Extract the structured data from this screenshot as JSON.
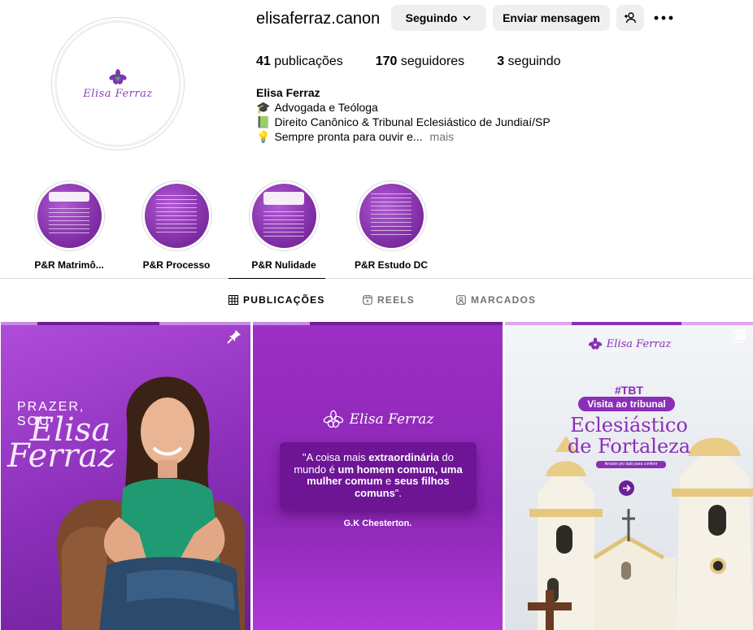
{
  "profile": {
    "username": "elisaferraz.canon",
    "avatar_logo_text": "Elisa Ferraz",
    "buttons": {
      "following": "Seguindo",
      "message": "Enviar mensagem"
    },
    "stats": {
      "posts_count": "41",
      "posts_label": "publicações",
      "followers_count": "170",
      "followers_label": "seguidores",
      "following_count": "3",
      "following_label": "seguindo"
    },
    "bio": {
      "name": "Elisa Ferraz",
      "line1_emoji": "🎓",
      "line1": "Advogada e Teóloga",
      "line2_emoji": "📗",
      "line2": "Direito Canônico & Tribunal Eclesiástico de Jundiaí/SP",
      "line3_emoji": "💡",
      "line3": "Sempre pronta para ouvir e...",
      "more": "mais"
    }
  },
  "highlights": [
    {
      "label": "P&R Matrimô..."
    },
    {
      "label": "P&R Processo"
    },
    {
      "label": "P&R Nulidade"
    },
    {
      "label": "P&R Estudo DC"
    }
  ],
  "tabs": [
    {
      "label": "PUBLICAÇÕES",
      "icon": "grid-icon",
      "active": true
    },
    {
      "label": "REELS",
      "icon": "reels-icon",
      "active": false
    },
    {
      "label": "MARCADOS",
      "icon": "tagged-icon",
      "active": false
    }
  ],
  "posts": [
    {
      "intro_line1": "PRAZER,",
      "intro_line2": "SOU",
      "script_line1": "Elisa",
      "script_line2": "Ferraz",
      "pinned": true
    },
    {
      "logo_text": "Elisa Ferraz",
      "quote_open": "\"A coisa mais ",
      "quote_b1": "extraordinária",
      "quote_mid": " do mundo é ",
      "quote_b2": "um homem comum, uma mulher comum",
      "quote_and": " e ",
      "quote_b3": "seus filhos comuns",
      "quote_close": "\".",
      "author": "G.K Chesterton."
    },
    {
      "logo_text": "Elisa Ferraz",
      "tag": "#TBT",
      "pill": "Visita ao tribunal",
      "title_line1": "Eclesiástico",
      "title_line2": "de Fortaleza",
      "subtitle": "Arraste p/o lado para conferir",
      "multi": true
    }
  ],
  "colors": {
    "brand_purple": "#8a2eb8",
    "button_bg": "#efefef",
    "muted_text": "#737373",
    "border": "#dbdbdb"
  }
}
